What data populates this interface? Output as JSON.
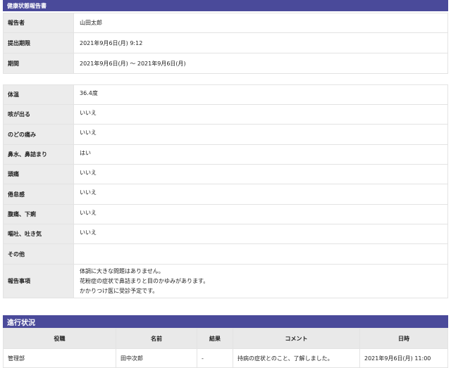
{
  "header": {
    "title": "健康状態報告書"
  },
  "report_info": [
    {
      "label": "報告者",
      "value": "山田太郎"
    },
    {
      "label": "提出期限",
      "value": "2021年9月6日(月) 9:12"
    },
    {
      "label": "期間",
      "value": "2021年9月6日(月) 〜 2021年9月6日(月)"
    }
  ],
  "health": [
    {
      "label": "体温",
      "value": "36.4度"
    },
    {
      "label": "咳が出る",
      "value": "いいえ"
    },
    {
      "label": "のどの痛み",
      "value": "いいえ"
    },
    {
      "label": "鼻水、鼻詰まり",
      "value": "はい"
    },
    {
      "label": "頭痛",
      "value": "いいえ"
    },
    {
      "label": "倦怠感",
      "value": "いいえ"
    },
    {
      "label": "腹痛、下痢",
      "value": "いいえ"
    },
    {
      "label": "嘔吐、吐き気",
      "value": "いいえ"
    },
    {
      "label": "その他",
      "value": ""
    }
  ],
  "notes": {
    "label": "報告事項",
    "lines": [
      "体調に大きな問題はありません。",
      "花粉症の症状で鼻詰まりと目のかゆみがあります。",
      "かかりつけ医に受診予定です。"
    ]
  },
  "progress": {
    "title": "進行状況",
    "columns": [
      "役職",
      "名前",
      "結果",
      "コメント",
      "日時"
    ],
    "rows": [
      [
        "管理部",
        "田中次郎",
        "-",
        "持病の症状とのこと、了解しました。",
        "2021年9月6日(月) 11:00"
      ]
    ]
  },
  "colors": {
    "header_bar": "#4a4a9a",
    "label_bg": "#ececec"
  }
}
